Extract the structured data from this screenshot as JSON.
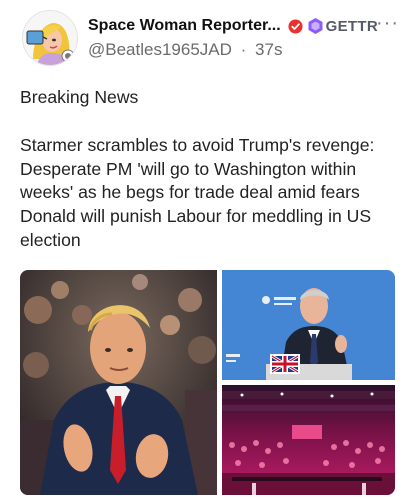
{
  "author": {
    "display_name": "Space Woman Reporter...",
    "handle": "@Beatles1965JAD",
    "separator": "·",
    "timestamp": "37s",
    "verified_icon": "verified-badge-icon",
    "platform_logo_icon": "gettr-logo-icon",
    "platform_name": "GETTR"
  },
  "menu": {
    "more_icon": "more-options-icon",
    "glyph": "···"
  },
  "post": {
    "label": "Breaking News",
    "headline": "Starmer scrambles to avoid Trump's revenge: Desperate PM 'will go to Washington within weeks' as he begs for trade deal amid fears Donald will punish Labour for meddling in US election"
  },
  "media": {
    "photo_count": 3,
    "flag_icon": "union-jack-flag-icon"
  },
  "colors": {
    "verified_red": "#e8322f",
    "gettr_purple": "#8b5cf6",
    "text_primary": "#1a1a1a",
    "text_secondary": "#6b6b6b",
    "stage_blue": "#4a8ad8",
    "crowd_pink": "#c21d6a"
  }
}
